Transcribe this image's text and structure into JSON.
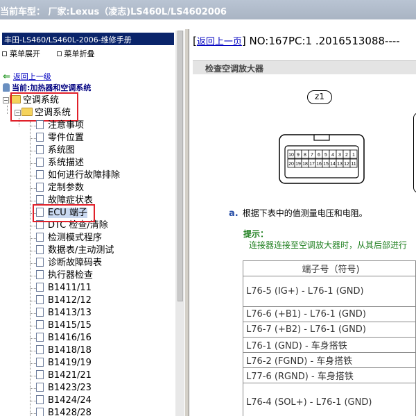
{
  "titlebar": {
    "text": "当前车型： 厂家:Lexus（凌志)LS460L/LS4602006"
  },
  "left": {
    "manual_header": "丰田-LS460/LS460L-2006-维修手册",
    "menu_expand": "菜单展开",
    "menu_collapse": "菜单折叠",
    "back_link": "返回上一级",
    "current": "当前:加热器和空调系统",
    "tree_root": "空调系统",
    "tree_child": "空调系统",
    "items": [
      "注意事项",
      "零件位置",
      "系统图",
      "系统描述",
      "如何进行故障排除",
      "定制参数",
      "故障症状表",
      "ECU 端子",
      "DTC 检查/清除",
      "检测模式程序",
      "数据表/主动测试",
      "诊断故障码表",
      "执行器检查",
      "B1411/11",
      "B1412/12",
      "B1413/13",
      "B1415/15",
      "B1416/16",
      "B1418/18",
      "B1419/19",
      "B1421/21",
      "B1423/23",
      "B1424/24",
      "B1428/28"
    ]
  },
  "right": {
    "back_link": "返回上一页",
    "doc_id": "NO:167PC:1 .2016513088----",
    "section_title": "检查空调放大器",
    "badge": "z1",
    "connector_top": [
      "10",
      "9",
      "8",
      "7",
      "6",
      "5",
      "4",
      "3",
      "2",
      "1"
    ],
    "connector_bottom": [
      "20",
      "19",
      "18",
      "17",
      "16",
      "15",
      "14",
      "13",
      "12",
      "11"
    ],
    "step_letter": "a.",
    "step_text": "根据下表中的值测量电压和电阻。",
    "hint_title": "提示：",
    "hint_body": "连接器连接至空调放大器时，从其后部进行",
    "table_header": "端子号（符号)",
    "table_rows": [
      "L76-5 (IG+) - L76-1 (GND)",
      "L76-6 (+B1) - L76-1 (GND)",
      "L76-7 (+B2) - L76-1 (GND)",
      "L76-1 (GND) - 车身搭铁",
      "L76-2 (FGND) - 车身搭铁",
      "L77-6 (RGND) - 车身搭铁",
      "L76-4 (SOL+) - L76-1 (GND)"
    ]
  }
}
